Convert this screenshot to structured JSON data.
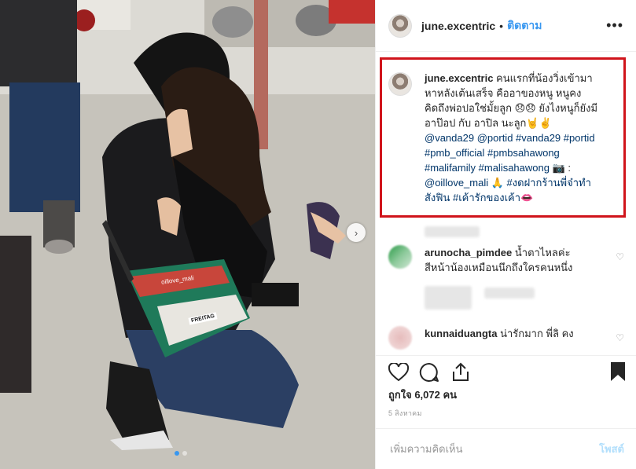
{
  "post": {
    "username": "june.excentric",
    "follow_label": "ติดตาม",
    "separator": "•",
    "more_label": "•••"
  },
  "photo": {
    "bag_label": "oillove_mali",
    "bag_brand": "FREITAG",
    "carousel_total": 2,
    "carousel_active": 1,
    "next_arrow": "›"
  },
  "caption": {
    "username": "june.excentric",
    "text_1": " คนแรกที่น้องวิ่งเข้ามาหาหลังเต้นเสร็จ คืออาของหนู หนูคงคิดถึงพ่อปอใช่มั้ยลูก 😞😞 ยังไงหนูก็ยังมีอาป๊อป กับ อาปิล นะลูก🤘✌️ ",
    "mention_1": "@vanda29",
    "mention_2": "@portid",
    "hashtag_1": "#vanda29",
    "hashtag_2": "#portid",
    "hashtag_3": "#pmb_official",
    "hashtag_4": "#pmbsahawong",
    "hashtag_5": "#malifamily",
    "hashtag_6": "#malisahawong",
    "camera": " 📷 : ",
    "mention_3": "@oillove_mali",
    "pray": " 🙏 ",
    "hashtag_7": "#งดฝากร้านพี่จ๋าทำสังฟิน",
    "hashtag_8": "#เค้ารักของเค้า",
    "lips": "👄"
  },
  "comments": [
    {
      "username": "arunocha_pimdee",
      "text": " น้ำตาไหลค่ะ สีหน้าน้องเหมือนนึกถึงใครคนหนึ่ง",
      "heart_icon": "heart-outline-icon"
    },
    {
      "username": "kunnaiduangta",
      "text": " น่ารักมาก พี่ลิ คง",
      "heart_icon": "heart-outline-icon"
    }
  ],
  "actions": {
    "like_icon": "heart-icon",
    "comment_icon": "comment-icon",
    "share_icon": "share-icon",
    "save_icon": "bookmark-icon"
  },
  "likes_text": "ถูกใจ 6,072 คน",
  "date_text": "5 สิงหาคม",
  "add_comment": {
    "placeholder": "เพิ่มความคิดเห็น",
    "post_label": "โพสต์"
  },
  "colors": {
    "follow": "#3897f0",
    "highlight_border": "#d0141b",
    "link": "#003569"
  }
}
